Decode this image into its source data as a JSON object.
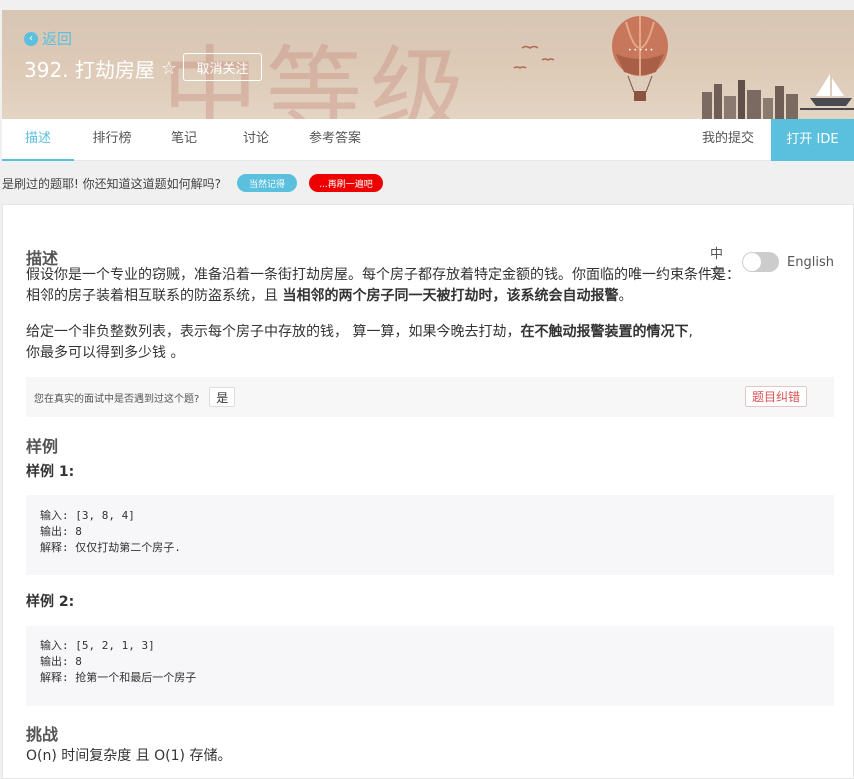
{
  "banner": {
    "back_label": "返回",
    "title": "392. 打劫房屋",
    "star_icon": "☆",
    "unfollow_label": "取消关注",
    "bg_text": "中等级"
  },
  "tabs": [
    {
      "label": "描述",
      "active": true
    },
    {
      "label": "排行榜"
    },
    {
      "label": "笔记"
    },
    {
      "label": "讨论"
    },
    {
      "label": "参考答案"
    }
  ],
  "my_submission_label": "我的提交",
  "open_ide_label": "打开 IDE",
  "strip": {
    "question": "是刷过的题耶! 你还知道这道题如何解吗?",
    "remember_label": "当然记得",
    "redo_label": "...再刷一遍吧"
  },
  "description": {
    "heading": "描述",
    "lang_cn": "中文",
    "lang_en": "English",
    "p1_a": "假设你是一个专业的窃贼，准备沿着一条街打劫房屋。每个房子都存放着特定金额的钱。你面临的唯一约束条件是：",
    "p1_b": "相邻的房子装着相互联系的防盗系统，且 ",
    "p1_b_bold": "当相邻的两个房子同一天被打劫时，该系统会自动报警",
    "p1_b_end": "。",
    "p2_a": "给定一个非负整数列表，表示每个房子中存放的钱， 算一算，如果今晚去打劫，",
    "p2_a_bold": "在不触动报警装置的情况下",
    "p2_a_end": ",",
    "p2_b": "你最多可以得到多少钱 。"
  },
  "interview": {
    "question": "您在真实的面试中是否遇到过这个题?",
    "yes_label": "是",
    "report_label": "题目纠错"
  },
  "examples": {
    "heading": "样例",
    "ex1_title": "样例 1:",
    "ex1_lines": [
      "输入: [3, 8, 4]",
      "输出: 8",
      "解释: 仅仅打劫第二个房子."
    ],
    "ex2_title": "样例 2:",
    "ex2_lines": [
      "输入: [5, 2, 1, 3]",
      "输出: 8",
      "解释: 抢第一个和最后一个房子"
    ]
  },
  "challenge": {
    "heading": "挑战",
    "text": "O(n) 时间复杂度 且 O(1) 存储。"
  },
  "colors": {
    "accent": "#5bc0de",
    "danger": "#e00000"
  }
}
